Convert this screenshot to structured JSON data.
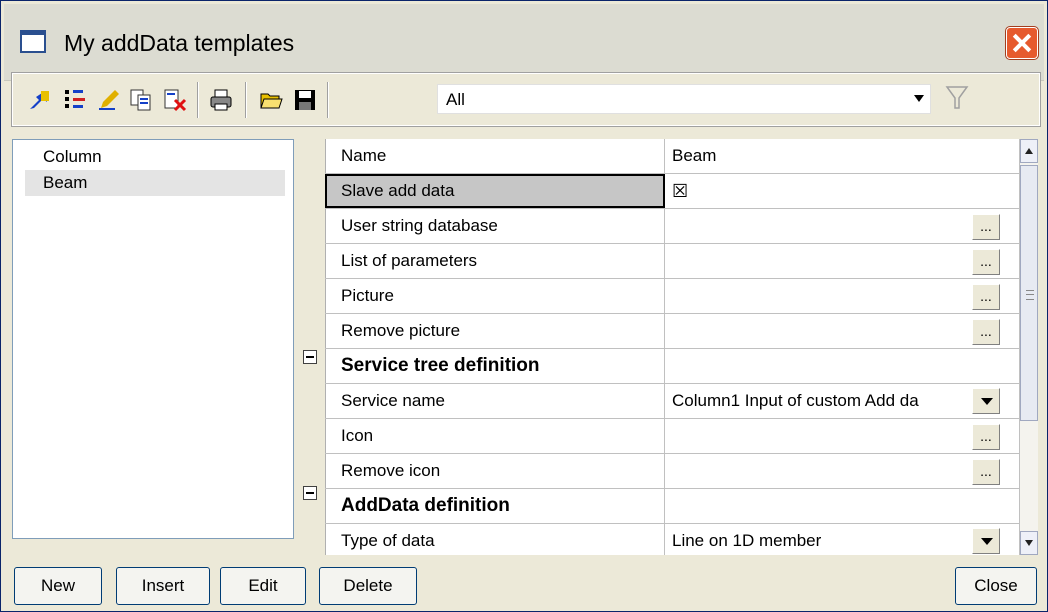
{
  "window": {
    "title": "My addData templates"
  },
  "toolbar": {
    "icons": [
      "new-template-icon",
      "properties-icon",
      "edit-icon",
      "copy-icon",
      "delete-icon",
      "print-icon",
      "open-folder-icon",
      "save-icon"
    ],
    "filter_value": "All"
  },
  "template_list": {
    "items": [
      {
        "label": "Column",
        "selected": false
      },
      {
        "label": "Beam",
        "selected": true
      }
    ]
  },
  "properties": {
    "rows": [
      {
        "name": "Name",
        "value": "Beam"
      },
      {
        "name": "Slave add data",
        "value": "☒"
      },
      {
        "name": "User string database",
        "value": "",
        "button": "..."
      },
      {
        "name": "List of parameters",
        "value": "",
        "button": "..."
      },
      {
        "name": "Picture",
        "value": "",
        "button": "..."
      },
      {
        "name": "Remove picture",
        "value": "",
        "button": "..."
      },
      {
        "name": "Service tree definition",
        "value": ""
      },
      {
        "name": "Service name",
        "value": "Column1 Input of custom Add da"
      },
      {
        "name": "Icon",
        "value": "",
        "button": "..."
      },
      {
        "name": "Remove icon",
        "value": "",
        "button": "..."
      },
      {
        "name": "AddData definition",
        "value": ""
      },
      {
        "name": "Type of data",
        "value": "Line on 1D member"
      }
    ]
  },
  "buttons": {
    "new": "New",
    "insert": "Insert",
    "edit": "Edit",
    "delete": "Delete",
    "close": "Close"
  }
}
